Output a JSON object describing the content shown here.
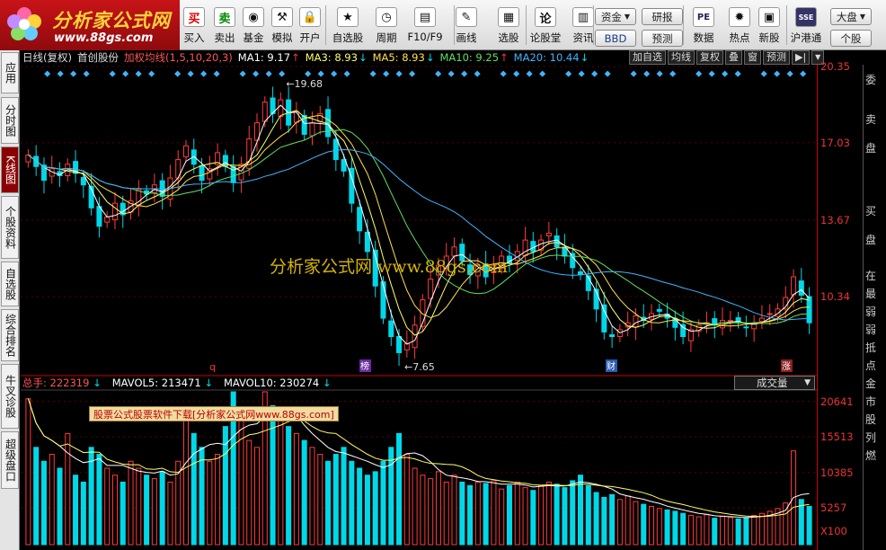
{
  "brand": {
    "logo_text": "分析家公式网",
    "logo_url": "www.88gs.com"
  },
  "toolbar": {
    "buttons": [
      {
        "id": "buy",
        "label": "买入",
        "icon_text": "买"
      },
      {
        "id": "sell",
        "label": "卖出",
        "icon_text": "卖"
      },
      {
        "id": "fund",
        "label": "基金",
        "icon_text": "◉"
      },
      {
        "id": "sim",
        "label": "模拟",
        "icon_text": "⚒"
      },
      {
        "id": "open",
        "label": "开户",
        "icon_text": "🔒"
      },
      {
        "id": "watch",
        "label": "自选股",
        "icon_text": "★"
      },
      {
        "id": "period",
        "label": "周期",
        "icon_text": "◷"
      },
      {
        "id": "f10",
        "label": "F10/F9",
        "icon_text": "▤"
      },
      {
        "id": "draw",
        "label": "画线",
        "icon_text": "✎"
      },
      {
        "id": "pick",
        "label": "选股",
        "icon_text": "▦"
      },
      {
        "id": "forum",
        "label": "论股堂",
        "icon_text": "论"
      },
      {
        "id": "news",
        "label": "资讯",
        "icon_text": "▥"
      },
      {
        "id": "data",
        "label": "数据",
        "icon_text": "PE"
      },
      {
        "id": "hot",
        "label": "热点",
        "icon_text": "✹"
      },
      {
        "id": "newstock",
        "label": "新股",
        "icon_text": "▣"
      },
      {
        "id": "hkconnect",
        "label": "沪港通",
        "icon_text": "SSE"
      }
    ],
    "pills": {
      "capital": "资金",
      "bbd": "BBD",
      "research": "研报",
      "forecast": "预测",
      "market": "大盘",
      "indiv": "个股"
    }
  },
  "side_tabs": [
    {
      "label": "应用",
      "active": false
    },
    {
      "label": "分时图",
      "active": false
    },
    {
      "label": "K线图",
      "active": true
    },
    {
      "label": "个股资料",
      "active": false
    },
    {
      "label": "自选股",
      "active": false
    },
    {
      "label": "综合排名",
      "active": false
    },
    {
      "label": "牛叉诊股",
      "active": false
    },
    {
      "label": "超级盘口",
      "active": false
    }
  ],
  "info_bar": {
    "period": "日线(复权)",
    "stock_name": "首创股份",
    "indicator": "加权均线(1,5,10,20,3)",
    "ma1": "MA1: 9.17",
    "ma3": "MA3: 8.93",
    "ma5": "MA5: 8.93",
    "ma10": "MA10: 9.25",
    "ma20": "MA20: 10.44"
  },
  "chart_buttons": [
    "加自选",
    "均线",
    "复权",
    "叠",
    "窗",
    "预测",
    "▶|"
  ],
  "right_panel": {
    "labels": [
      "委",
      "卖",
      "盘",
      "买",
      "盘",
      "在",
      "最",
      "弱",
      "弱",
      "抵",
      "点",
      "金",
      "市",
      "股",
      "列",
      "燃"
    ]
  },
  "watermark": "分析家公式网  www.88gs.com",
  "markers": {
    "q": "q",
    "bang": "榜",
    "cai": "财",
    "zhang": "涨"
  },
  "volume": {
    "header": {
      "total": "总手: 222319",
      "mavol5": "MAVOL5: 213471",
      "mavol10": "MAVOL10: 230274"
    },
    "dropdown": "成交量",
    "ad_text": "股票公式股票软件下载[分析家公式网www.88gs.com]"
  },
  "colors": {
    "up": "#ff3b3b",
    "down": "#00d8e8",
    "ma1": "#ffffff",
    "ma3": "#ffff66",
    "ma5": "#ffe04a",
    "ma10": "#60e060",
    "ma20": "#40b4ff",
    "axis": "#ff3333"
  },
  "chart_data": [
    {
      "type": "candlestick",
      "title": "",
      "y_axis_ticks": [
        20.35,
        17.03,
        13.67,
        10.34
      ],
      "ylim": [
        6.9,
        20.35
      ],
      "annotations": [
        {
          "label": "19.68",
          "kind": "high"
        },
        {
          "label": "7.65",
          "kind": "low"
        }
      ],
      "closes": [
        16.5,
        16.0,
        15.4,
        15.9,
        15.6,
        16.1,
        15.7,
        15.2,
        14.2,
        13.4,
        13.8,
        14.4,
        13.9,
        14.5,
        15.0,
        14.8,
        15.2,
        14.7,
        15.5,
        16.3,
        16.9,
        16.1,
        15.4,
        15.9,
        16.6,
        16.0,
        15.3,
        16.1,
        17.2,
        17.9,
        18.8,
        18.3,
        18.9,
        17.8,
        18.4,
        17.4,
        17.9,
        18.3,
        17.3,
        16.3,
        15.8,
        14.4,
        13.2,
        12.3,
        10.8,
        9.4,
        8.6,
        7.9,
        8.3,
        9.1,
        10.2,
        11.1,
        11.7,
        12.1,
        12.5,
        11.9,
        11.3,
        11.7,
        11.2,
        11.7,
        12.1,
        11.8,
        12.3,
        12.8,
        12.3,
        12.8,
        13.1,
        12.5,
        12.1,
        11.6,
        11.3,
        10.6,
        9.8,
        8.8,
        8.6,
        8.9,
        9.2,
        9.5,
        9.3,
        9.6,
        9.7,
        9.4,
        9.0,
        8.6,
        8.9,
        9.1,
        9.2,
        9.1,
        9.3,
        9.3,
        9.2,
        9.0,
        9.2,
        9.4,
        9.6,
        9.8,
        10.3,
        11.2,
        10.4,
        9.2
      ]
    },
    {
      "type": "bar",
      "title": "",
      "y_axis_ticks": [
        20641,
        15513,
        10385,
        5257
      ],
      "y_unit": "X100",
      "ylim": [
        0,
        22000
      ],
      "values": [
        21000,
        14000,
        12000,
        13000,
        11000,
        16000,
        10000,
        9000,
        14000,
        13000,
        11000,
        10000,
        9000,
        12000,
        11000,
        10000,
        9500,
        10500,
        9000,
        12000,
        18000,
        16000,
        14000,
        12000,
        13000,
        17000,
        22000,
        19000,
        15000,
        14000,
        22000,
        20000,
        18000,
        17000,
        16000,
        15000,
        14000,
        13000,
        12000,
        13000,
        14000,
        12000,
        11000,
        10000,
        10500,
        12000,
        14000,
        16000,
        13000,
        11000,
        10000,
        9500,
        10500,
        9000,
        10000,
        9000,
        8500,
        9000,
        8800,
        9200,
        8000,
        8500,
        9000,
        8200,
        7800,
        8500,
        9000,
        8700,
        8200,
        9200,
        10000,
        8500,
        7500,
        6800,
        7200,
        6500,
        7000,
        6200,
        5800,
        5500,
        5200,
        5000,
        4800,
        4500,
        4200,
        4000,
        4300,
        3800,
        4100,
        3900,
        3700,
        3900,
        4200,
        4500,
        4800,
        5200,
        6000,
        13500,
        6500,
        5500
      ]
    }
  ]
}
